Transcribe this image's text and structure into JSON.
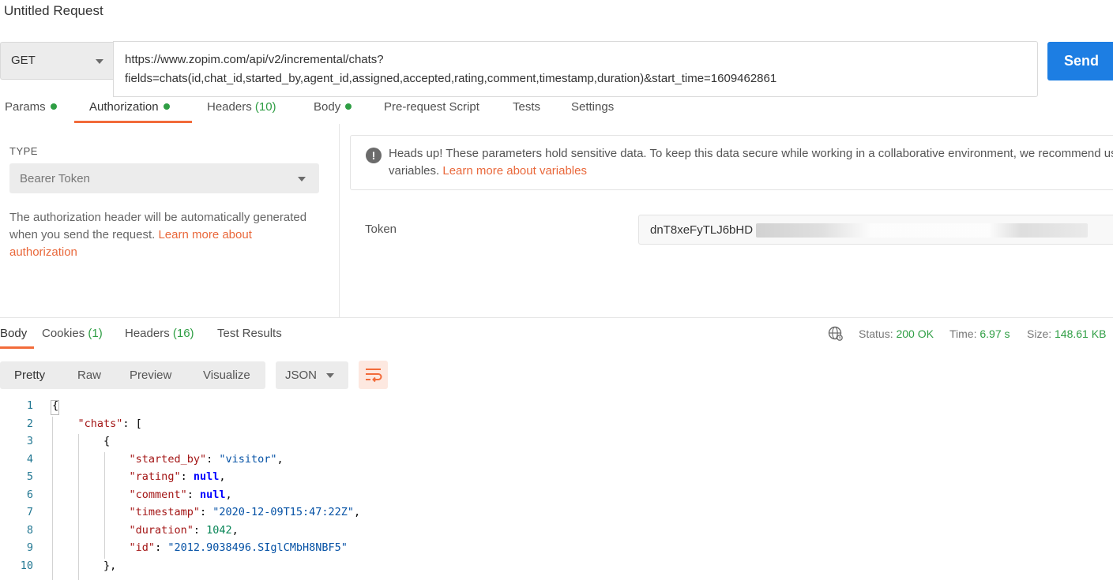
{
  "window": {
    "title": "Untitled Request"
  },
  "request": {
    "method": "GET",
    "url_line1": "https://www.zopim.com/api/v2/incremental/chats?",
    "url_line2": "fields=chats(id,chat_id,started_by,agent_id,assigned,accepted,rating,comment,timestamp,duration)&start_time=1609462861",
    "send_label": "Send"
  },
  "request_tabs": [
    {
      "label": "Params",
      "count": "",
      "dot": true
    },
    {
      "label": "Authorization",
      "count": "",
      "dot": true,
      "active": true
    },
    {
      "label": "Headers",
      "count": "(10)",
      "dot": false
    },
    {
      "label": "Body",
      "count": "",
      "dot": true
    },
    {
      "label": "Pre-request Script",
      "count": "",
      "dot": false
    },
    {
      "label": "Tests",
      "count": "",
      "dot": false
    },
    {
      "label": "Settings",
      "count": "",
      "dot": false
    }
  ],
  "auth": {
    "type_label": "TYPE",
    "type_value": "Bearer Token",
    "desc_text": "The authorization header will be automatically generated when you send the request. ",
    "desc_link": "Learn more about authorization",
    "headsup_line1": "Heads up! These parameters hold sensitive data. To keep this data secure while working in a collaborative environment, we recommend using",
    "headsup_line2": "variables. ",
    "headsup_link": "Learn more about variables",
    "token_label": "Token",
    "token_value": "dnT8xeFyTLJ6bHD"
  },
  "response_tabs": [
    {
      "label": "Body",
      "count": ""
    },
    {
      "label": "Cookies",
      "count": "(1)"
    },
    {
      "label": "Headers",
      "count": "(16)"
    },
    {
      "label": "Test Results",
      "count": ""
    }
  ],
  "status": {
    "status_label": "Status:",
    "status_value": "200 OK",
    "time_label": "Time:",
    "time_value": "6.97 s",
    "size_label": "Size:",
    "size_value": "148.61 KB"
  },
  "viewer": {
    "formats": [
      "Pretty",
      "Raw",
      "Preview",
      "Visualize"
    ],
    "language": "JSON"
  },
  "code_lines": [
    {
      "n": "1"
    },
    {
      "n": "2"
    },
    {
      "n": "3"
    },
    {
      "n": "4"
    },
    {
      "n": "5"
    },
    {
      "n": "6"
    },
    {
      "n": "7"
    },
    {
      "n": "8"
    },
    {
      "n": "9"
    },
    {
      "n": "10"
    }
  ],
  "json": {
    "chats_key": "\"chats\"",
    "started_by_key": "\"started_by\"",
    "started_by_val": "\"visitor\"",
    "rating_key": "\"rating\"",
    "rating_val": "null",
    "comment_key": "\"comment\"",
    "comment_val": "null",
    "timestamp_key": "\"timestamp\"",
    "timestamp_val": "\"2020-12-09T15:47:22Z\"",
    "duration_key": "\"duration\"",
    "duration_val": "1042",
    "id_key": "\"id\"",
    "id_val": "\"2012.9038496.SIglCMbH8NBF5\""
  },
  "icons": {
    "info": "info-icon",
    "globe": "globe-icon",
    "wrap": "wrap-lines-icon",
    "caret": "chevron-down-icon"
  },
  "colors": {
    "accent": "#f26b3a",
    "primary": "#1d7ee3",
    "success": "#2f9e44"
  }
}
